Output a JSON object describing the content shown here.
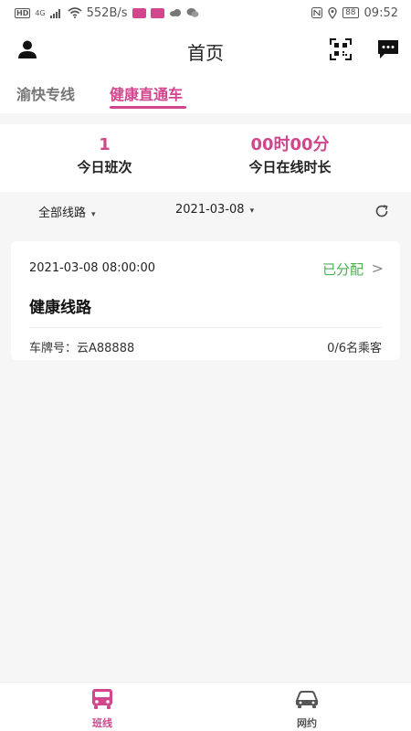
{
  "status_bar": {
    "network": "HD",
    "signal": "4G",
    "speed": "552B/s",
    "battery": "88",
    "time": "09:52"
  },
  "header": {
    "title": "首页",
    "icons": [
      "user-icon",
      "qr-scan-icon",
      "message-icon"
    ]
  },
  "tabs": [
    {
      "label": "渝快专线",
      "active": false
    },
    {
      "label": "健康直通车",
      "active": true
    }
  ],
  "stats": [
    {
      "value": "1",
      "label": "今日班次"
    },
    {
      "value": "00时00分",
      "label": "今日在线时长"
    }
  ],
  "filters": {
    "route": "全部线路",
    "date": "2021-03-08"
  },
  "trip": {
    "datetime": "2021-03-08 08:00:00",
    "status": "已分配",
    "route_name": "健康线路",
    "plate": "车牌号：云A88888",
    "passengers": "0/6名乘客"
  },
  "bottom_nav": [
    {
      "label": "班线",
      "active": true,
      "icon": "bus-icon"
    },
    {
      "label": "网约",
      "active": false,
      "icon": "car-icon"
    }
  ],
  "colors": {
    "accent": "#d1468c",
    "status_green": "#4caf50"
  }
}
